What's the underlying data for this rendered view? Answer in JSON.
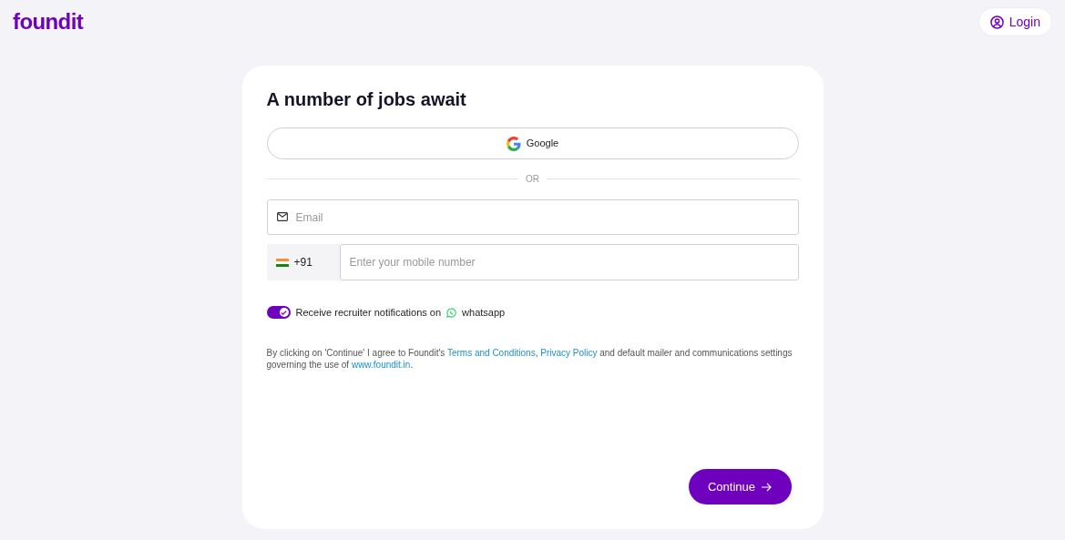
{
  "header": {
    "logo": "foundit",
    "login": "Login"
  },
  "card": {
    "title": "A number of jobs await",
    "google_button": "Google",
    "divider": "OR",
    "email": {
      "placeholder": "Email"
    },
    "mobile": {
      "country_code": "+91",
      "placeholder": "Enter your mobile number"
    },
    "whatsapp": {
      "on": true,
      "label": "Receive recruiter notifications on",
      "app": "whatsapp"
    },
    "consent": [
      {
        "kind": "text",
        "text": "By clicking on 'Continue' I agree to Foundit's "
      },
      {
        "kind": "link",
        "text": "Terms and Conditions"
      },
      {
        "kind": "text",
        "text": ", "
      },
      {
        "kind": "link",
        "text": "Privacy Policy"
      },
      {
        "kind": "text",
        "text": " and default mailer and communications settings governing the use of "
      },
      {
        "kind": "link",
        "text": "www.foundit.in"
      },
      {
        "kind": "text",
        "text": "."
      }
    ],
    "continue": "Continue"
  }
}
